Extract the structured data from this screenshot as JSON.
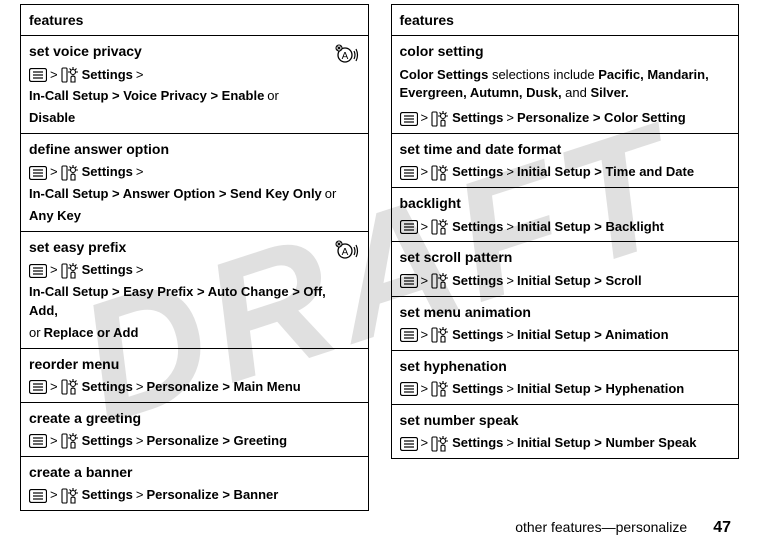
{
  "watermark": "DRAFT",
  "left": {
    "header": "features",
    "rows": [
      {
        "title": "set voice privacy",
        "path": [
          "Settings",
          ">",
          "In-Call Setup > Voice Privacy > Enable",
          "or",
          "Disable"
        ],
        "antenna": true
      },
      {
        "title": "define answer option",
        "path": [
          "Settings",
          ">",
          "In-Call Setup > Answer Option > Send Key Only",
          "or",
          "Any Key"
        ],
        "antenna": false
      },
      {
        "title": "set easy prefix",
        "path": [
          "Settings",
          ">",
          "In-Call Setup > Easy Prefix > Auto Change > Off, Add,",
          "or",
          "Replace or Add"
        ],
        "antenna": true
      },
      {
        "title": "reorder menu",
        "path": [
          "Settings",
          ">",
          "Personalize > Main Menu"
        ],
        "antenna": false
      },
      {
        "title": "create a greeting",
        "path": [
          "Settings",
          ">",
          "Personalize > Greeting"
        ],
        "antenna": false
      },
      {
        "title": "create a banner",
        "path": [
          "Settings",
          ">",
          "Personalize > Banner"
        ],
        "antenna": false
      }
    ]
  },
  "right": {
    "header": "features",
    "rows": [
      {
        "title": "color setting",
        "pre": {
          "before": "Color Settings",
          "mid": " selections include ",
          "items": "Pacific, Mandarin, Evergreen, Autumn, Dusk,",
          "and": " and ",
          "last": "Silver."
        },
        "path": [
          "Settings",
          ">",
          "Personalize > Color Setting"
        ]
      },
      {
        "title": "set time and date format",
        "path": [
          "Settings",
          ">",
          "Initial Setup > Time and Date"
        ]
      },
      {
        "title": "backlight",
        "path": [
          "Settings",
          ">",
          "Initial Setup > Backlight"
        ]
      },
      {
        "title": "set scroll pattern",
        "path": [
          "Settings",
          ">",
          "Initial Setup > Scroll"
        ]
      },
      {
        "title": "set menu animation",
        "path": [
          "Settings",
          ">",
          "Initial Setup > Animation"
        ]
      },
      {
        "title": "set hyphenation",
        "path": [
          "Settings",
          ">",
          "Initial Setup > Hyphenation"
        ]
      },
      {
        "title": "set number speak",
        "path": [
          "Settings",
          ">",
          "Initial Setup > Number Speak"
        ]
      }
    ]
  },
  "footer": {
    "text": "other features—personalize",
    "page": "47"
  }
}
